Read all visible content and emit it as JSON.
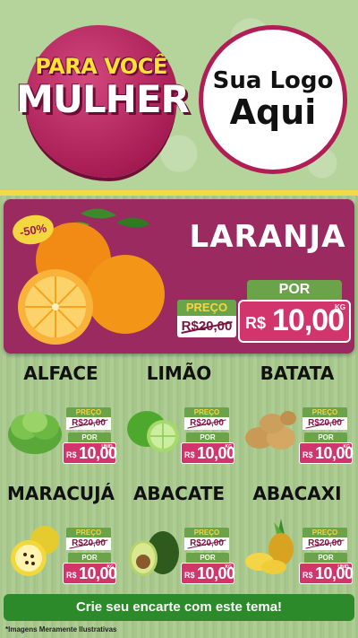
{
  "header": {
    "badge_line1": "PARA VOCÊ",
    "badge_line2": "MULHER",
    "logo_line1": "Sua Logo",
    "logo_line2": "Aqui"
  },
  "feature": {
    "name": "LARANJA",
    "discount": "-50%",
    "old_label": "PREÇO",
    "old_price": "R$20,00",
    "new_label": "POR",
    "currency": "R$",
    "new_price": "10,00",
    "unit": "KG"
  },
  "products": [
    {
      "name": "ALFACE",
      "old_label": "PREÇO",
      "old_price": "R$20,00",
      "new_label": "POR",
      "currency": "R$",
      "new_price": "10,00",
      "unit": "UNID."
    },
    {
      "name": "LIMÃO",
      "old_label": "PREÇO",
      "old_price": "R$20,00",
      "new_label": "POR",
      "currency": "R$",
      "new_price": "10,00",
      "unit": "KG"
    },
    {
      "name": "BATATA",
      "old_label": "PREÇO",
      "old_price": "R$20,00",
      "new_label": "POR",
      "currency": "R$",
      "new_price": "10,00",
      "unit": "KG"
    },
    {
      "name": "MARACUJÁ",
      "old_label": "PREÇO",
      "old_price": "R$20,00",
      "new_label": "POR",
      "currency": "R$",
      "new_price": "10,00",
      "unit": "KG"
    },
    {
      "name": "ABACATE",
      "old_label": "PREÇO",
      "old_price": "R$20,00",
      "new_label": "POR",
      "currency": "R$",
      "new_price": "10,00",
      "unit": "KG"
    },
    {
      "name": "ABACAXI",
      "old_label": "PREÇO",
      "old_price": "R$20,00",
      "new_label": "POR",
      "currency": "R$",
      "new_price": "10,00",
      "unit": "UNID."
    }
  ],
  "cta": "Crie seu encarte com este tema!",
  "disclaimer": "*Imagens Meramente Ilustrativas",
  "colors": {
    "magenta": "#9a2a5f",
    "pink": "#d1356b",
    "green": "#6aa34a",
    "yellow": "#f4d641"
  }
}
